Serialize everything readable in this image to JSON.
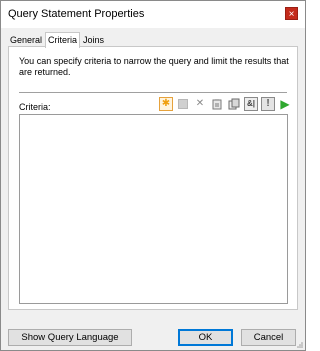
{
  "window": {
    "title": "Query Statement Properties",
    "close_symbol": "×"
  },
  "tabs": [
    {
      "label": "General",
      "active": false
    },
    {
      "label": "Criteria",
      "active": true
    },
    {
      "label": "Joins",
      "active": false
    }
  ],
  "criteria_tab": {
    "description": "You can specify criteria to narrow the query and limit the results that are returned.",
    "criteria_label": "Criteria:",
    "toolbar_icons": [
      "new-criterion-icon",
      "criterion-properties-icon",
      "delete-icon",
      "clipboard-icon",
      "group-icon",
      "and-icon",
      "not-icon",
      "run-icon"
    ],
    "toolbar_texts": {
      "new": "✱",
      "delete": "✕",
      "and": "&|",
      "not": "!",
      "run": "▶"
    }
  },
  "footer": {
    "show_query_label": "Show Query Language",
    "ok_label": "OK",
    "cancel_label": "Cancel"
  },
  "colors": {
    "accent": "#0078d7",
    "close": "#c42b1c",
    "run": "#2fa82f",
    "new": "#f0a010"
  }
}
